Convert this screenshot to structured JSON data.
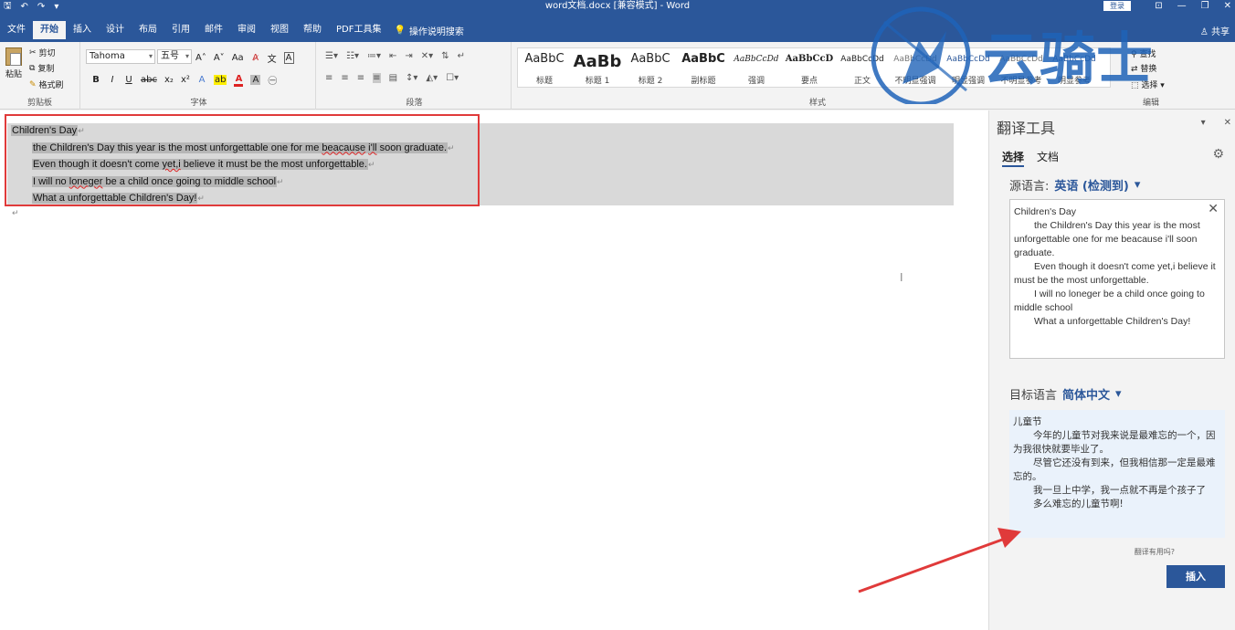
{
  "titlebar": {
    "doc_title": "word文档.docx [兼容模式] - Word",
    "login": "登录",
    "qat_save": "🖫",
    "qat_undo": "↶",
    "qat_redo": "↷",
    "qat_more": "▾",
    "ctrl_layout": "⊡",
    "ctrl_min": "—",
    "ctrl_max": "❐",
    "ctrl_close": "✕"
  },
  "menu": {
    "tabs": [
      "文件",
      "开始",
      "插入",
      "设计",
      "布局",
      "引用",
      "邮件",
      "审阅",
      "视图",
      "帮助",
      "PDF工具集"
    ],
    "tell_me": "操作说明搜索",
    "share": "♙ 共享"
  },
  "ribbon": {
    "clipboard": {
      "paste": "粘贴",
      "cut": "剪切",
      "copy": "复制",
      "format_painter": "格式刷",
      "label": "剪贴板"
    },
    "font": {
      "name": "Tahoma",
      "size": "五号",
      "label": "字体"
    },
    "paragraph": {
      "label": "段落"
    },
    "styles": {
      "label": "样式",
      "items": [
        {
          "sample": "AaBbC",
          "name": "标题"
        },
        {
          "sample": "AaBb",
          "name": "标题 1"
        },
        {
          "sample": "AaBbC",
          "name": "标题 2"
        },
        {
          "sample": "AaBbC",
          "name": "副标题"
        },
        {
          "sample": "AaBbCcDd",
          "name": "强调"
        },
        {
          "sample": "AaBbCcD",
          "name": "要点"
        },
        {
          "sample": "AaBbCcDd",
          "name": "正文"
        },
        {
          "sample": "AaBbCcDd",
          "name": "不明显强调"
        },
        {
          "sample": "AaBbCcDd",
          "name": "明显强调"
        },
        {
          "sample": "AaBbCcDd",
          "name": "不明显参考"
        },
        {
          "sample": "AaBbCcDd",
          "name": "明显参考"
        }
      ]
    },
    "editing": {
      "find": "查找",
      "replace": "替换",
      "select": "选择",
      "label": "编辑"
    }
  },
  "document": {
    "lines": [
      "Children's Day",
      "the Children's Day this year is the most unforgettable one for me beacause i'll soon graduate.",
      "Even though it doesn't come yet,i believe it must be the most unforgettable.",
      "I will no loneger be a child once going to middle school",
      "What a unforgettable Children's Day!"
    ]
  },
  "translator": {
    "title": "翻译工具",
    "tab_selection": "选择",
    "tab_document": "文档",
    "source_label": "源语言:",
    "source_lang": "英语 (检测到)",
    "source_lines": [
      "Children's Day",
      "the Children's Day this year is the most unforgettable one for me beacause i'll soon graduate.",
      "Even though it doesn't come yet,i believe it must be the most unforgettable.",
      "I will no loneger be a child once going to middle school",
      "What a unforgettable Children's Day!"
    ],
    "target_label": "目标语言",
    "target_lang": "简体中文",
    "target_lines": [
      "儿童节",
      "今年的儿童节对我来说是最难忘的一个，因为我很快就要毕业了。",
      "尽管它还没有到来，但我相信那一定是最难忘的。",
      "我一旦上中学，我一点就不再是个孩子了",
      "多么难忘的儿童节啊!"
    ],
    "helpful": "翻译有用吗?",
    "insert": "插入"
  },
  "watermark": {
    "text": "云骑士"
  },
  "colors": {
    "word_blue": "#2b579a",
    "annotation_red": "#e03a3a"
  }
}
